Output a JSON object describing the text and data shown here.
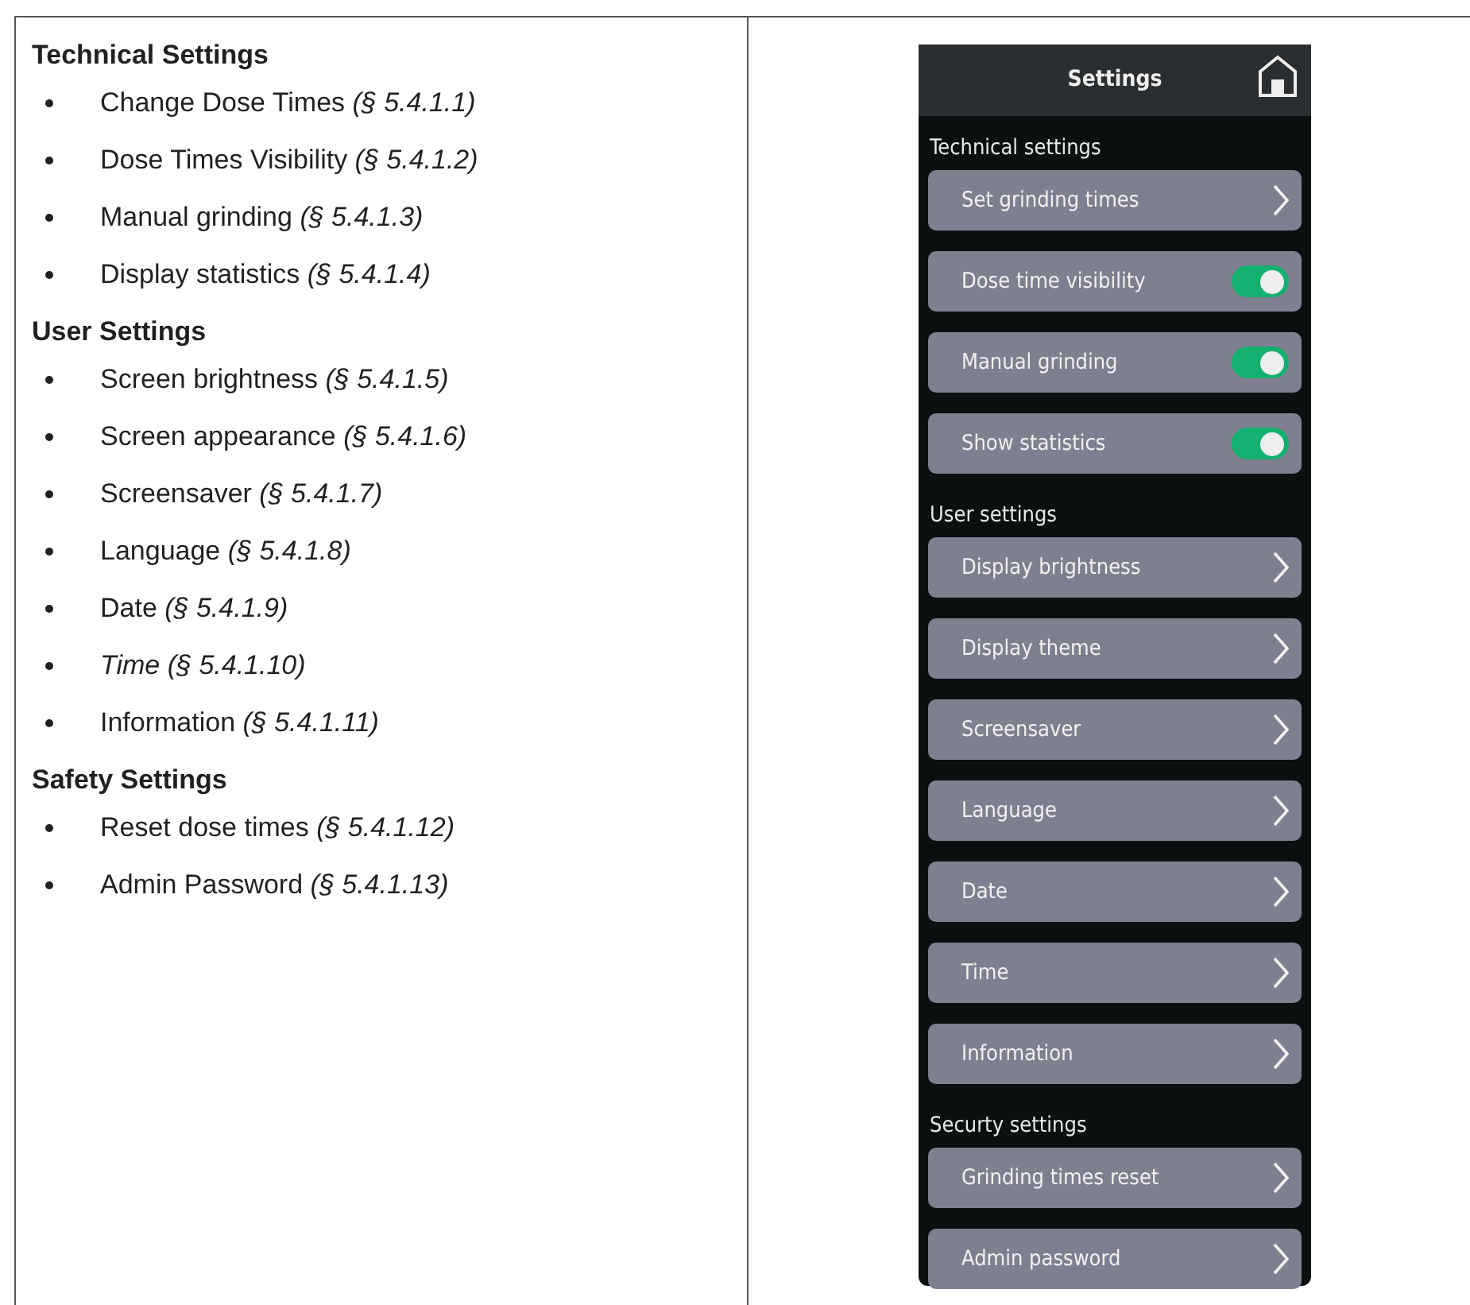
{
  "manual": {
    "sections": [
      {
        "heading": "Technical Settings",
        "items": [
          {
            "text": "Change Dose Times *(§ 5.4.1.1)*",
            "italic": false
          },
          {
            "text": "Dose Times Visibility *(§ 5.4.1.2)*",
            "italic": false
          },
          {
            "text": "Manual grinding *(§ 5.4.1.3)*",
            "italic": false
          },
          {
            "text": "Display statistics *(§ 5.4.1.4)*",
            "italic": false
          }
        ]
      },
      {
        "heading": "User Settings",
        "items": [
          {
            "text": "Screen brightness *(§ 5.4.1.5)*",
            "italic": false
          },
          {
            "text": "Screen appearance *(§ 5.4.1.6)*",
            "italic": false
          },
          {
            "text": "Screensaver *(§ 5.4.1.7)*",
            "italic": false
          },
          {
            "text": "Language *(§ 5.4.1.8)*",
            "italic": false
          },
          {
            "text": "Date *(§ 5.4.1.9)*",
            "italic": false
          },
          {
            "text": "Time (§ 5.4.1.10)",
            "italic": true
          },
          {
            "text": "Information *(§ 5.4.1.11)*",
            "italic": false
          }
        ]
      },
      {
        "heading": "Safety Settings",
        "items": [
          {
            "text": "Reset dose times *(§ 5.4.1.12)*",
            "italic": false
          },
          {
            "text": "Admin Password *(§ 5.4.1.13)*",
            "italic": false
          }
        ]
      }
    ]
  },
  "device": {
    "title": "Settings",
    "groups": [
      {
        "label": "Technical settings",
        "rows": [
          {
            "kind": "link",
            "label": "Set grinding times"
          },
          {
            "kind": "toggle",
            "label": "Dose time visibility",
            "on": true
          },
          {
            "kind": "toggle",
            "label": "Manual grinding",
            "on": true
          },
          {
            "kind": "toggle",
            "label": "Show statistics",
            "on": true
          }
        ]
      },
      {
        "label": "User settings",
        "rows": [
          {
            "kind": "link",
            "label": "Display brightness"
          },
          {
            "kind": "link",
            "label": "Display theme"
          },
          {
            "kind": "link",
            "label": "Screensaver"
          },
          {
            "kind": "link",
            "label": "Language"
          },
          {
            "kind": "link",
            "label": "Date"
          },
          {
            "kind": "link",
            "label": "Time"
          },
          {
            "kind": "link",
            "label": "Information"
          }
        ]
      },
      {
        "label": "Securty settings",
        "rows": [
          {
            "kind": "link",
            "label": "Grinding times reset"
          },
          {
            "kind": "link",
            "label": "Admin password"
          }
        ]
      }
    ]
  }
}
